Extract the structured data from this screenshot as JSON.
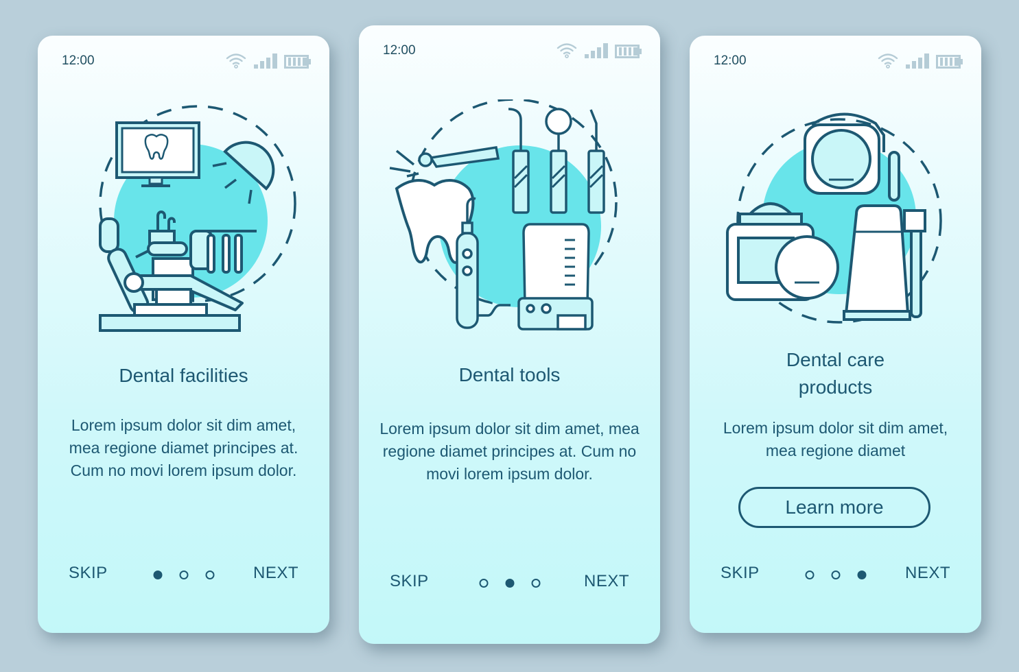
{
  "colors": {
    "background": "#b9cfda",
    "accent": "#1d5872",
    "highlight_circle": "#68e4ea",
    "fill_light": "#c9f6f8",
    "status_icon": "#b5ccd6"
  },
  "screens": [
    {
      "status": {
        "time": "12:00",
        "icons": [
          "wifi-icon",
          "signal-icon",
          "battery-icon"
        ]
      },
      "illustration": "dental-chair-illustration",
      "title": "Dental facilities",
      "body": "Lorem ipsum dolor sit dim amet, mea regione diamet principes at. Cum no movi lorem ipsum dolor.",
      "footer": {
        "skip": "SKIP",
        "next": "NEXT",
        "active_page": 1,
        "total_pages": 3
      }
    },
    {
      "status": {
        "time": "12:00",
        "icons": [
          "wifi-icon",
          "signal-icon",
          "battery-icon"
        ]
      },
      "illustration": "dental-tools-illustration",
      "title": "Dental tools",
      "body": "Lorem ipsum dolor sit dim amet, mea regione diamet principes at. Cum no movi lorem ipsum dolor.",
      "footer": {
        "skip": "SKIP",
        "next": "NEXT",
        "active_page": 2,
        "total_pages": 3
      }
    },
    {
      "status": {
        "time": "12:00",
        "icons": [
          "wifi-icon",
          "signal-icon",
          "battery-icon"
        ]
      },
      "illustration": "dental-care-products-illustration",
      "title": "Dental care products",
      "body": "Lorem ipsum dolor sit dim amet, mea regione diamet",
      "button": "Learn more",
      "footer": {
        "skip": "SKIP",
        "next": "NEXT",
        "active_page": 3,
        "total_pages": 3
      }
    }
  ]
}
